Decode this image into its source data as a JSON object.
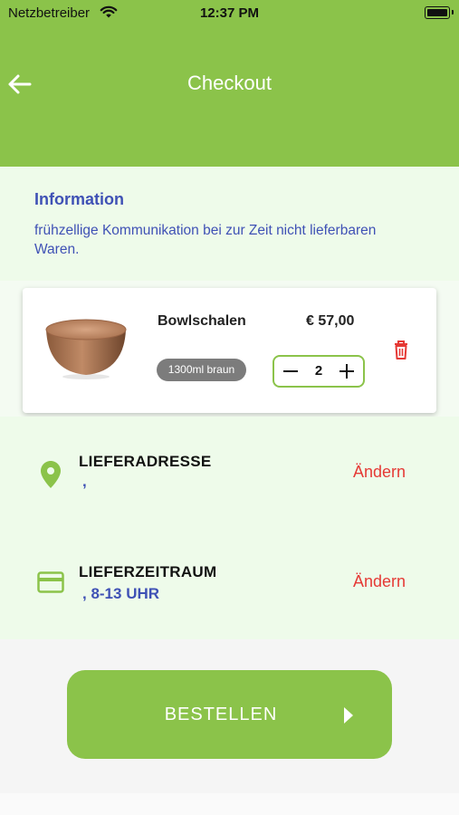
{
  "status_bar": {
    "carrier": "Netzbetreiber",
    "time": "12:37 PM"
  },
  "header": {
    "title": "Checkout"
  },
  "info": {
    "title": "Information",
    "text": "frühzellige Kommunikation bei zur Zeit nicht lieferbaren Waren."
  },
  "cart_item": {
    "name": "Bowlschalen",
    "price": "€ 57,00",
    "variant": "1300ml braun",
    "quantity": "2"
  },
  "delivery_address": {
    "title": "LIEFERADRESSE",
    "value": ",",
    "edit_label": "Ändern"
  },
  "delivery_time": {
    "title": "LIEFERZEITRAUM",
    "value": ", 8-13 UHR",
    "edit_label": "Ändern"
  },
  "order_button": {
    "label": "BESTELLEN"
  },
  "colors": {
    "brand_green": "#8bc34a",
    "accent_blue": "#3f51b5",
    "danger_red": "#e53935"
  }
}
